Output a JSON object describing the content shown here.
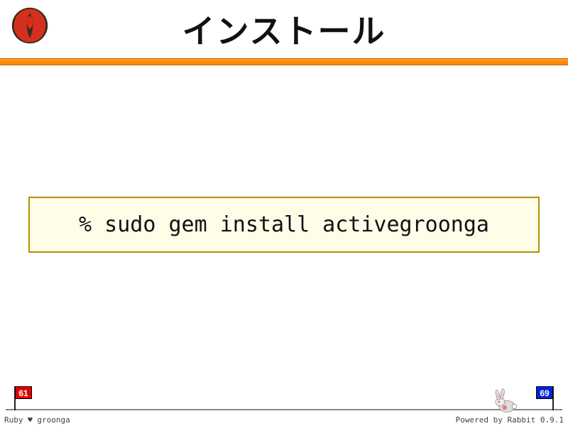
{
  "slide": {
    "title": "インストール",
    "code": "% sudo gem install activegroonga"
  },
  "footer": {
    "current_page": "61",
    "total_pages": "69",
    "credit_left": "Ruby ♥ groonga",
    "credit_right": "Powered by Rabbit 0.9.1"
  }
}
